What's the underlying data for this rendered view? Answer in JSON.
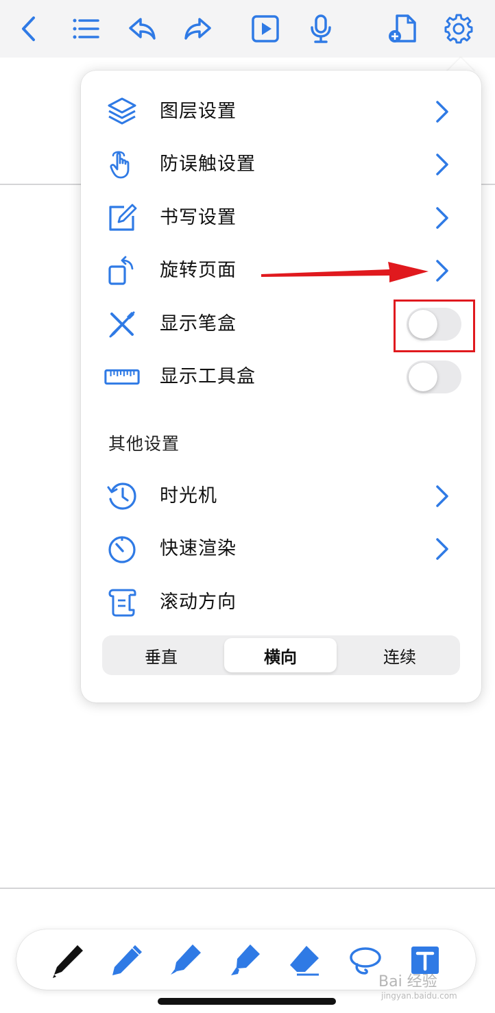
{
  "colors": {
    "accent": "#2f7ae5",
    "topbar_bg": "#f4f4f5",
    "annotation_red": "#e0191e"
  },
  "topbar": {
    "icons": [
      "back-chevron",
      "outline-list",
      "undo",
      "redo",
      "play",
      "microphone",
      "add-page",
      "gear"
    ]
  },
  "menu": {
    "items": [
      {
        "label": "图层设置",
        "icon": "layers-icon",
        "control": "chevron"
      },
      {
        "label": "防误触设置",
        "icon": "hand-touch-icon",
        "control": "chevron"
      },
      {
        "label": "书写设置",
        "icon": "edit-square-icon",
        "control": "chevron"
      },
      {
        "label": "旋转页面",
        "icon": "rotate-page-icon",
        "control": "chevron"
      },
      {
        "label": "显示笔盒",
        "icon": "pencils-cross-icon",
        "control": "toggle",
        "on": false
      },
      {
        "label": "显示工具盒",
        "icon": "ruler-icon",
        "control": "toggle",
        "on": false
      }
    ],
    "section_title": "其他设置",
    "other_items": [
      {
        "label": "时光机",
        "icon": "history-clock-icon",
        "control": "chevron"
      },
      {
        "label": "快速渲染",
        "icon": "timer-icon",
        "control": "chevron"
      },
      {
        "label": "滚动方向",
        "icon": "scroll-icon",
        "control": "none"
      }
    ],
    "scroll_direction": {
      "options": [
        "垂直",
        "横向",
        "连续"
      ],
      "selected": "横向"
    }
  },
  "toolbar": {
    "tools": [
      "pen-icon",
      "pencil-icon",
      "marker-icon",
      "highlighter-icon",
      "eraser-icon",
      "lasso-icon",
      "text-box-icon"
    ]
  },
  "watermark": {
    "text": "Bai 经验",
    "sub": "jingyan.baidu.com"
  }
}
